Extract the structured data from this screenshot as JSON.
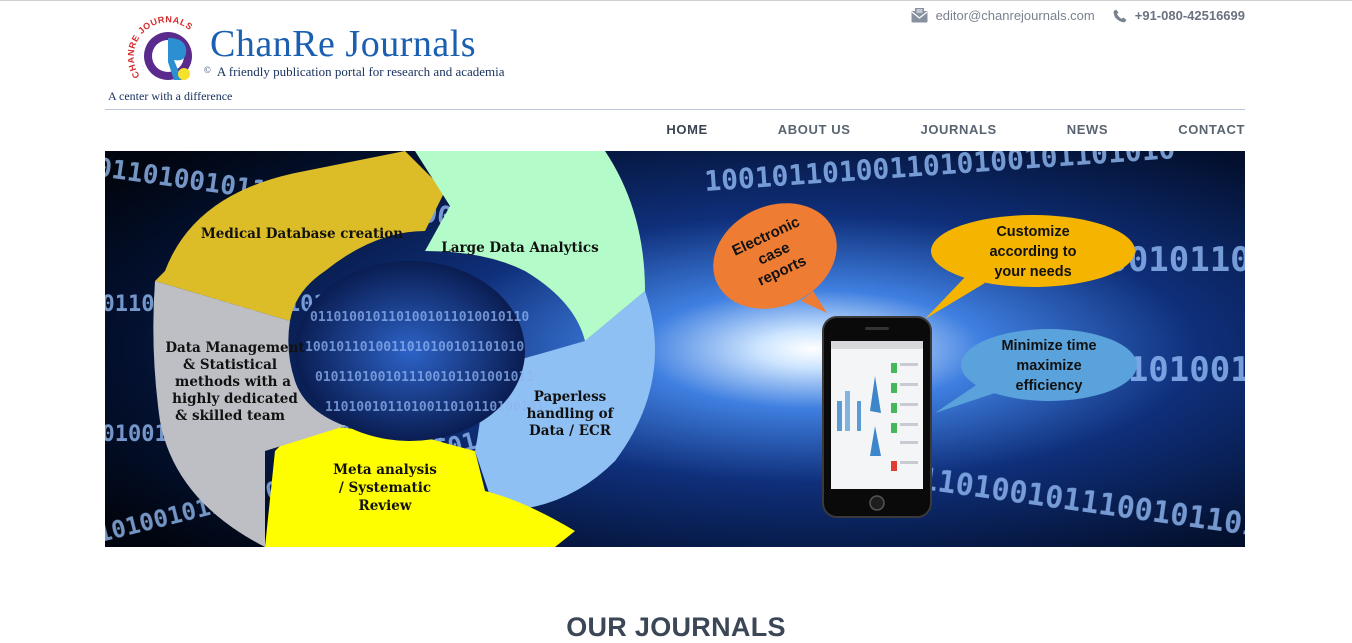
{
  "header": {
    "brand_name": "ChanRe Journals",
    "copyright_mark": "©",
    "tagline": "A friendly publication portal for research and academia",
    "motto": "A center with a difference",
    "logo_ring_text": "CHANRE JOURNALS",
    "email": "editor@chanrejournals.com",
    "phone": "+91-080-42516699",
    "email_icon": "envelope-icon",
    "phone_icon": "phone-icon"
  },
  "nav": {
    "items": [
      {
        "label": "HOME",
        "active": true
      },
      {
        "label": "ABOUT US"
      },
      {
        "label": "JOURNALS"
      },
      {
        "label": "NEWS"
      },
      {
        "label": "CONTACT"
      }
    ]
  },
  "hero": {
    "segments": {
      "medical": "Medical Database creation",
      "analytics": "Large Data Analytics",
      "paperless": [
        "Paperless",
        "handling of",
        "Data / ECR"
      ],
      "meta": [
        "Meta analysis",
        "/ Systematic",
        "Review"
      ],
      "management": [
        "Data Management",
        "& Statistical",
        "methods with a",
        "highly dedicated",
        "& skilled team"
      ]
    },
    "bubbles": {
      "electronic": [
        "Electronic",
        "case",
        "reports"
      ],
      "customize": [
        "Customize",
        "according to",
        "your needs"
      ],
      "minimize": [
        "Minimize time",
        "maximize",
        "efficiency"
      ]
    },
    "binary_rows": [
      "0110100101101001011010010110",
      "1001011010011010100101101010",
      "0101101001011100101101001011",
      "1101001011010011010110100101"
    ]
  },
  "main": {
    "section_title": "OUR JOURNALS"
  },
  "colors": {
    "brand_blue": "#1a5fb0",
    "nav_text": "#5a6470",
    "title_text": "#3b4756",
    "segment_gold": "#dcbd28",
    "segment_mint": "#b3fbc8",
    "segment_lightblue": "#8fc0f4",
    "segment_yellow": "#fefe00",
    "segment_grey": "#bdbfc4",
    "bubble_orange": "#ee7c33",
    "bubble_amber": "#f4b400",
    "bubble_blue": "#5aa2dc"
  }
}
